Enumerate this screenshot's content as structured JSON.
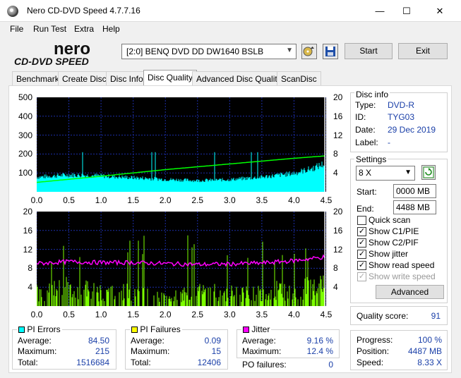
{
  "window": {
    "title": "Nero CD-DVD Speed 4.7.7.16"
  },
  "menu": [
    "File",
    "Run Test",
    "Extra",
    "Help"
  ],
  "toolbar": {
    "drive": "[2:0]   BENQ DVD DD DW1640 BSLB",
    "start_label": "Start",
    "exit_label": "Exit",
    "logo_top": "nero",
    "logo_bottom": "CD-DVD SPEED"
  },
  "tabs": [
    "Benchmark",
    "Create Disc",
    "Disc Info",
    "Disc Quality",
    "Advanced Disc Quality",
    "ScanDisc"
  ],
  "active_tab": "Disc Quality",
  "disc_info": {
    "title": "Disc info",
    "type_label": "Type:",
    "type": "DVD-R",
    "id_label": "ID:",
    "id": "TYG03",
    "date_label": "Date:",
    "date": "29 Dec 2019",
    "label_label": "Label:",
    "label": "-"
  },
  "settings": {
    "title": "Settings",
    "speed": "8 X",
    "start_label": "Start:",
    "start": "0000 MB",
    "end_label": "End:",
    "end": "4488 MB",
    "checks": [
      {
        "label": "Quick scan",
        "checked": false,
        "disabled": false
      },
      {
        "label": "Show C1/PIE",
        "checked": true,
        "disabled": false
      },
      {
        "label": "Show C2/PIF",
        "checked": true,
        "disabled": false
      },
      {
        "label": "Show jitter",
        "checked": true,
        "disabled": false
      },
      {
        "label": "Show read speed",
        "checked": true,
        "disabled": false
      },
      {
        "label": "Show write speed",
        "checked": true,
        "disabled": true
      }
    ],
    "advanced_label": "Advanced"
  },
  "quality": {
    "label": "Quality score:",
    "value": "91"
  },
  "progress": {
    "progress_label": "Progress:",
    "progress": "100 %",
    "position_label": "Position:",
    "position": "4487 MB",
    "speed_label": "Speed:",
    "speed": "8.33 X"
  },
  "pi_errors": {
    "title": "PI Errors",
    "color": "#00ffff",
    "avg_label": "Average:",
    "avg": "84.50",
    "max_label": "Maximum:",
    "max": "215",
    "total_label": "Total:",
    "total": "1516684"
  },
  "pi_failures": {
    "title": "PI Failures",
    "color": "#ffff00",
    "avg_label": "Average:",
    "avg": "0.09",
    "max_label": "Maximum:",
    "max": "15",
    "total_label": "Total:",
    "total": "12406"
  },
  "jitter": {
    "title": "Jitter",
    "color": "#ff00ff",
    "avg_label": "Average:",
    "avg": "9.16 %",
    "max_label": "Maximum:",
    "max": "12.4 %",
    "po_label": "PO failures:",
    "po": "0"
  },
  "chart_data": [
    {
      "type": "area",
      "series": [
        {
          "color": "#00ffff",
          "shape": "dense bars rising from ~80 at 0.0 to ~90 at 0.5, dipping to ~60 at 2.5, rising to ~140 at 4.4",
          "values": [
            [
              0.0,
              78
            ],
            [
              0.5,
              90
            ],
            [
              1.0,
              85
            ],
            [
              1.5,
              75
            ],
            [
              2.0,
              66
            ],
            [
              2.5,
              60
            ],
            [
              3.0,
              65
            ],
            [
              3.5,
              78
            ],
            [
              4.0,
              98
            ],
            [
              4.3,
              125
            ],
            [
              4.48,
              150
            ]
          ]
        },
        {
          "color": "#00ff00",
          "name": "read speed",
          "values": [
            [
              0.0,
              2.0
            ],
            [
              1.0,
              3.3
            ],
            [
              2.0,
              4.7
            ],
            [
              3.0,
              5.9
            ],
            [
              4.0,
              7.1
            ],
            [
              4.48,
              7.6
            ]
          ]
        }
      ],
      "x_ticks": [
        "0.0",
        "0.5",
        "1.0",
        "1.5",
        "2.0",
        "2.5",
        "3.0",
        "3.5",
        "4.0",
        "4.5"
      ],
      "y_left_ticks": [
        "500",
        "400",
        "300",
        "200",
        "100"
      ],
      "y_right_ticks": [
        "20",
        "16",
        "12",
        "8",
        "4"
      ],
      "xlim": [
        0,
        4.5
      ],
      "ylim_left": [
        0,
        500
      ],
      "ylim_right": [
        0,
        20
      ]
    },
    {
      "type": "area",
      "series": [
        {
          "color": "#7cff00",
          "shape": "sparse spikes mostly 1-5 with peaks up to 15",
          "values": [
            [
              0.0,
              3
            ],
            [
              0.5,
              4
            ],
            [
              1.0,
              3
            ],
            [
              1.5,
              3
            ],
            [
              2.0,
              2
            ],
            [
              2.5,
              3
            ],
            [
              3.0,
              3
            ],
            [
              3.5,
              3
            ],
            [
              4.0,
              4
            ],
            [
              4.48,
              5
            ]
          ]
        },
        {
          "color": "#ff00ff",
          "name": "jitter",
          "values": [
            [
              0.0,
              9.0
            ],
            [
              0.5,
              9.4
            ],
            [
              1.0,
              9.2
            ],
            [
              1.5,
              9.2
            ],
            [
              2.0,
              9.0
            ],
            [
              2.5,
              8.8
            ],
            [
              3.0,
              8.9
            ],
            [
              3.5,
              9.1
            ],
            [
              4.0,
              9.6
            ],
            [
              4.48,
              10.4
            ]
          ]
        }
      ],
      "x_ticks": [
        "0.0",
        "0.5",
        "1.0",
        "1.5",
        "2.0",
        "2.5",
        "3.0",
        "3.5",
        "4.0",
        "4.5"
      ],
      "y_left_ticks": [
        "20",
        "16",
        "12",
        "8",
        "4"
      ],
      "y_right_ticks": [
        "20",
        "16",
        "12",
        "8",
        "4"
      ],
      "xlim": [
        0,
        4.5
      ],
      "ylim_left": [
        0,
        20
      ],
      "ylim_right": [
        0,
        20
      ]
    }
  ]
}
